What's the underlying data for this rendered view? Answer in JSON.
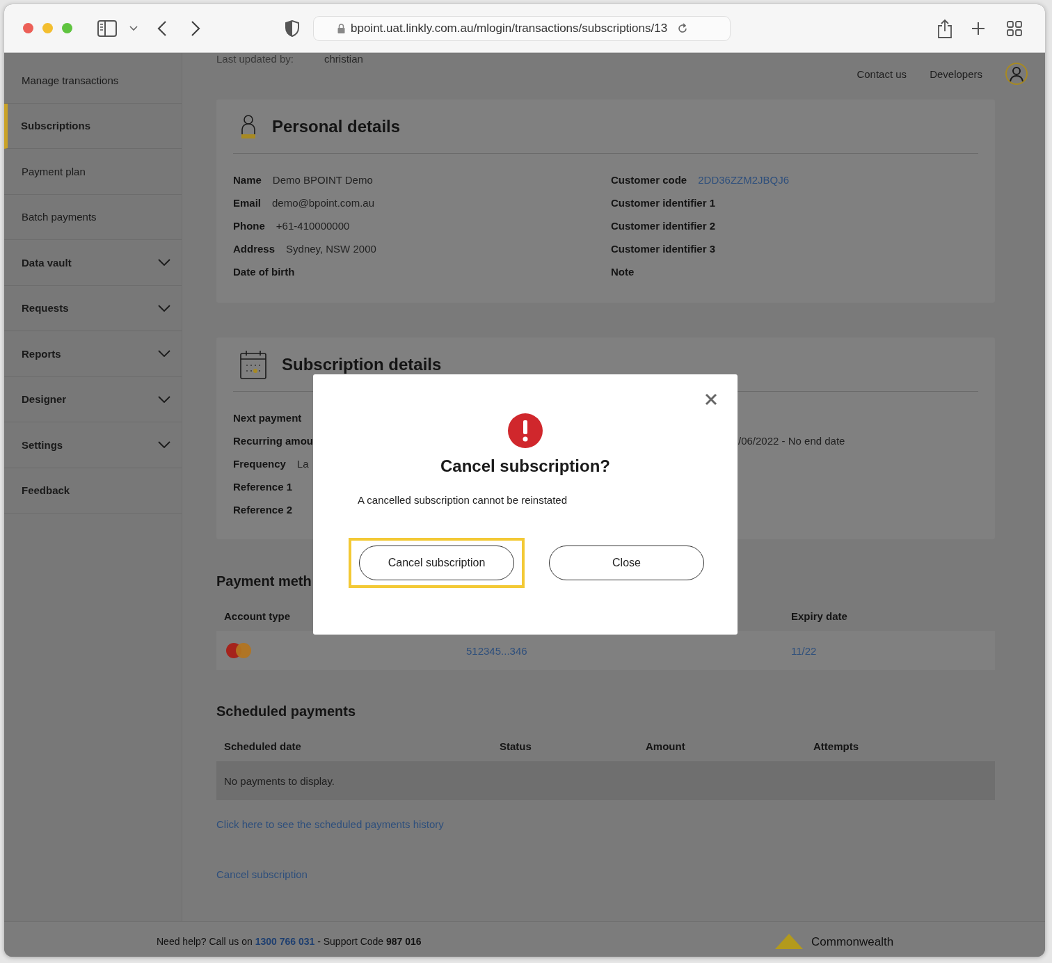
{
  "browser": {
    "url": "bpoint.uat.linkly.com.au/mlogin/transactions/subscriptions/13"
  },
  "sidebar": {
    "items": [
      {
        "label": "Manage transactions",
        "kind": "page",
        "selected": false
      },
      {
        "label": "Subscriptions",
        "kind": "page",
        "selected": true
      },
      {
        "label": "Payment plan",
        "kind": "page",
        "selected": false
      },
      {
        "label": "Batch payments",
        "kind": "page",
        "selected": false
      },
      {
        "label": "Data vault",
        "kind": "menu",
        "selected": false
      },
      {
        "label": "Requests",
        "kind": "menu",
        "selected": false
      },
      {
        "label": "Reports",
        "kind": "menu",
        "selected": false
      },
      {
        "label": "Designer",
        "kind": "menu",
        "selected": false
      },
      {
        "label": "Settings",
        "kind": "menu",
        "selected": false
      },
      {
        "label": "Feedback",
        "kind": "top",
        "selected": false
      }
    ]
  },
  "header": {
    "last_updated_label": "Last updated by:",
    "last_updated_value": "christian",
    "links": [
      "Contact us",
      "Developers"
    ]
  },
  "personal": {
    "title": "Personal details",
    "left": [
      {
        "label": "Name",
        "value": "Demo BPOINT Demo",
        "kind": "text"
      },
      {
        "label": "Email",
        "value": "demo@bpoint.com.au",
        "kind": "text"
      },
      {
        "label": "Phone",
        "value": "+61-410000000",
        "kind": "text"
      },
      {
        "label": "Address",
        "value": "Sydney, NSW 2000",
        "kind": "text"
      },
      {
        "label": "Date of birth"
      }
    ],
    "right": [
      {
        "label": "Customer code",
        "value": "2DD36ZZM2JBQJ6",
        "kind": "link"
      },
      {
        "label": "Customer identifier 1"
      },
      {
        "label": "Customer identifier 2"
      },
      {
        "label": "Customer identifier 3"
      },
      {
        "label": "Note"
      }
    ]
  },
  "subscription": {
    "title": "Subscription details",
    "rows": [
      {
        "label": "Next payment"
      },
      {
        "label": "Recurring amou",
        "right_value": "/06/2022 - No end date"
      },
      {
        "label": "Frequency",
        "value": "La"
      },
      {
        "label": "Reference 1"
      },
      {
        "label": "Reference 2"
      }
    ]
  },
  "payment_method": {
    "title": "Payment meth",
    "columns": [
      "Account type",
      "Expiry date"
    ],
    "rows": [
      {
        "number": "512345...346",
        "expiry": "11/22"
      }
    ]
  },
  "scheduled": {
    "title": "Scheduled payments",
    "columns": [
      "Scheduled date",
      "Status",
      "Amount",
      "Attempts"
    ],
    "empty": "No payments to display.",
    "history_link": "Click here to see the scheduled payments history",
    "cancel_link": "Cancel subscription"
  },
  "footer": {
    "lead": "Need help? Call us on",
    "phone": "1300 766 031",
    "support": " - Support Code **987 016**",
    "brand": "Commonwealth"
  },
  "modal": {
    "title": "Cancel subscription?",
    "message": "A cancelled subscription cannot be reinstated",
    "buttons": [
      {
        "label": "Cancel subscription",
        "highlighted": true
      },
      {
        "label": "Close",
        "highlighted": false
      }
    ]
  }
}
